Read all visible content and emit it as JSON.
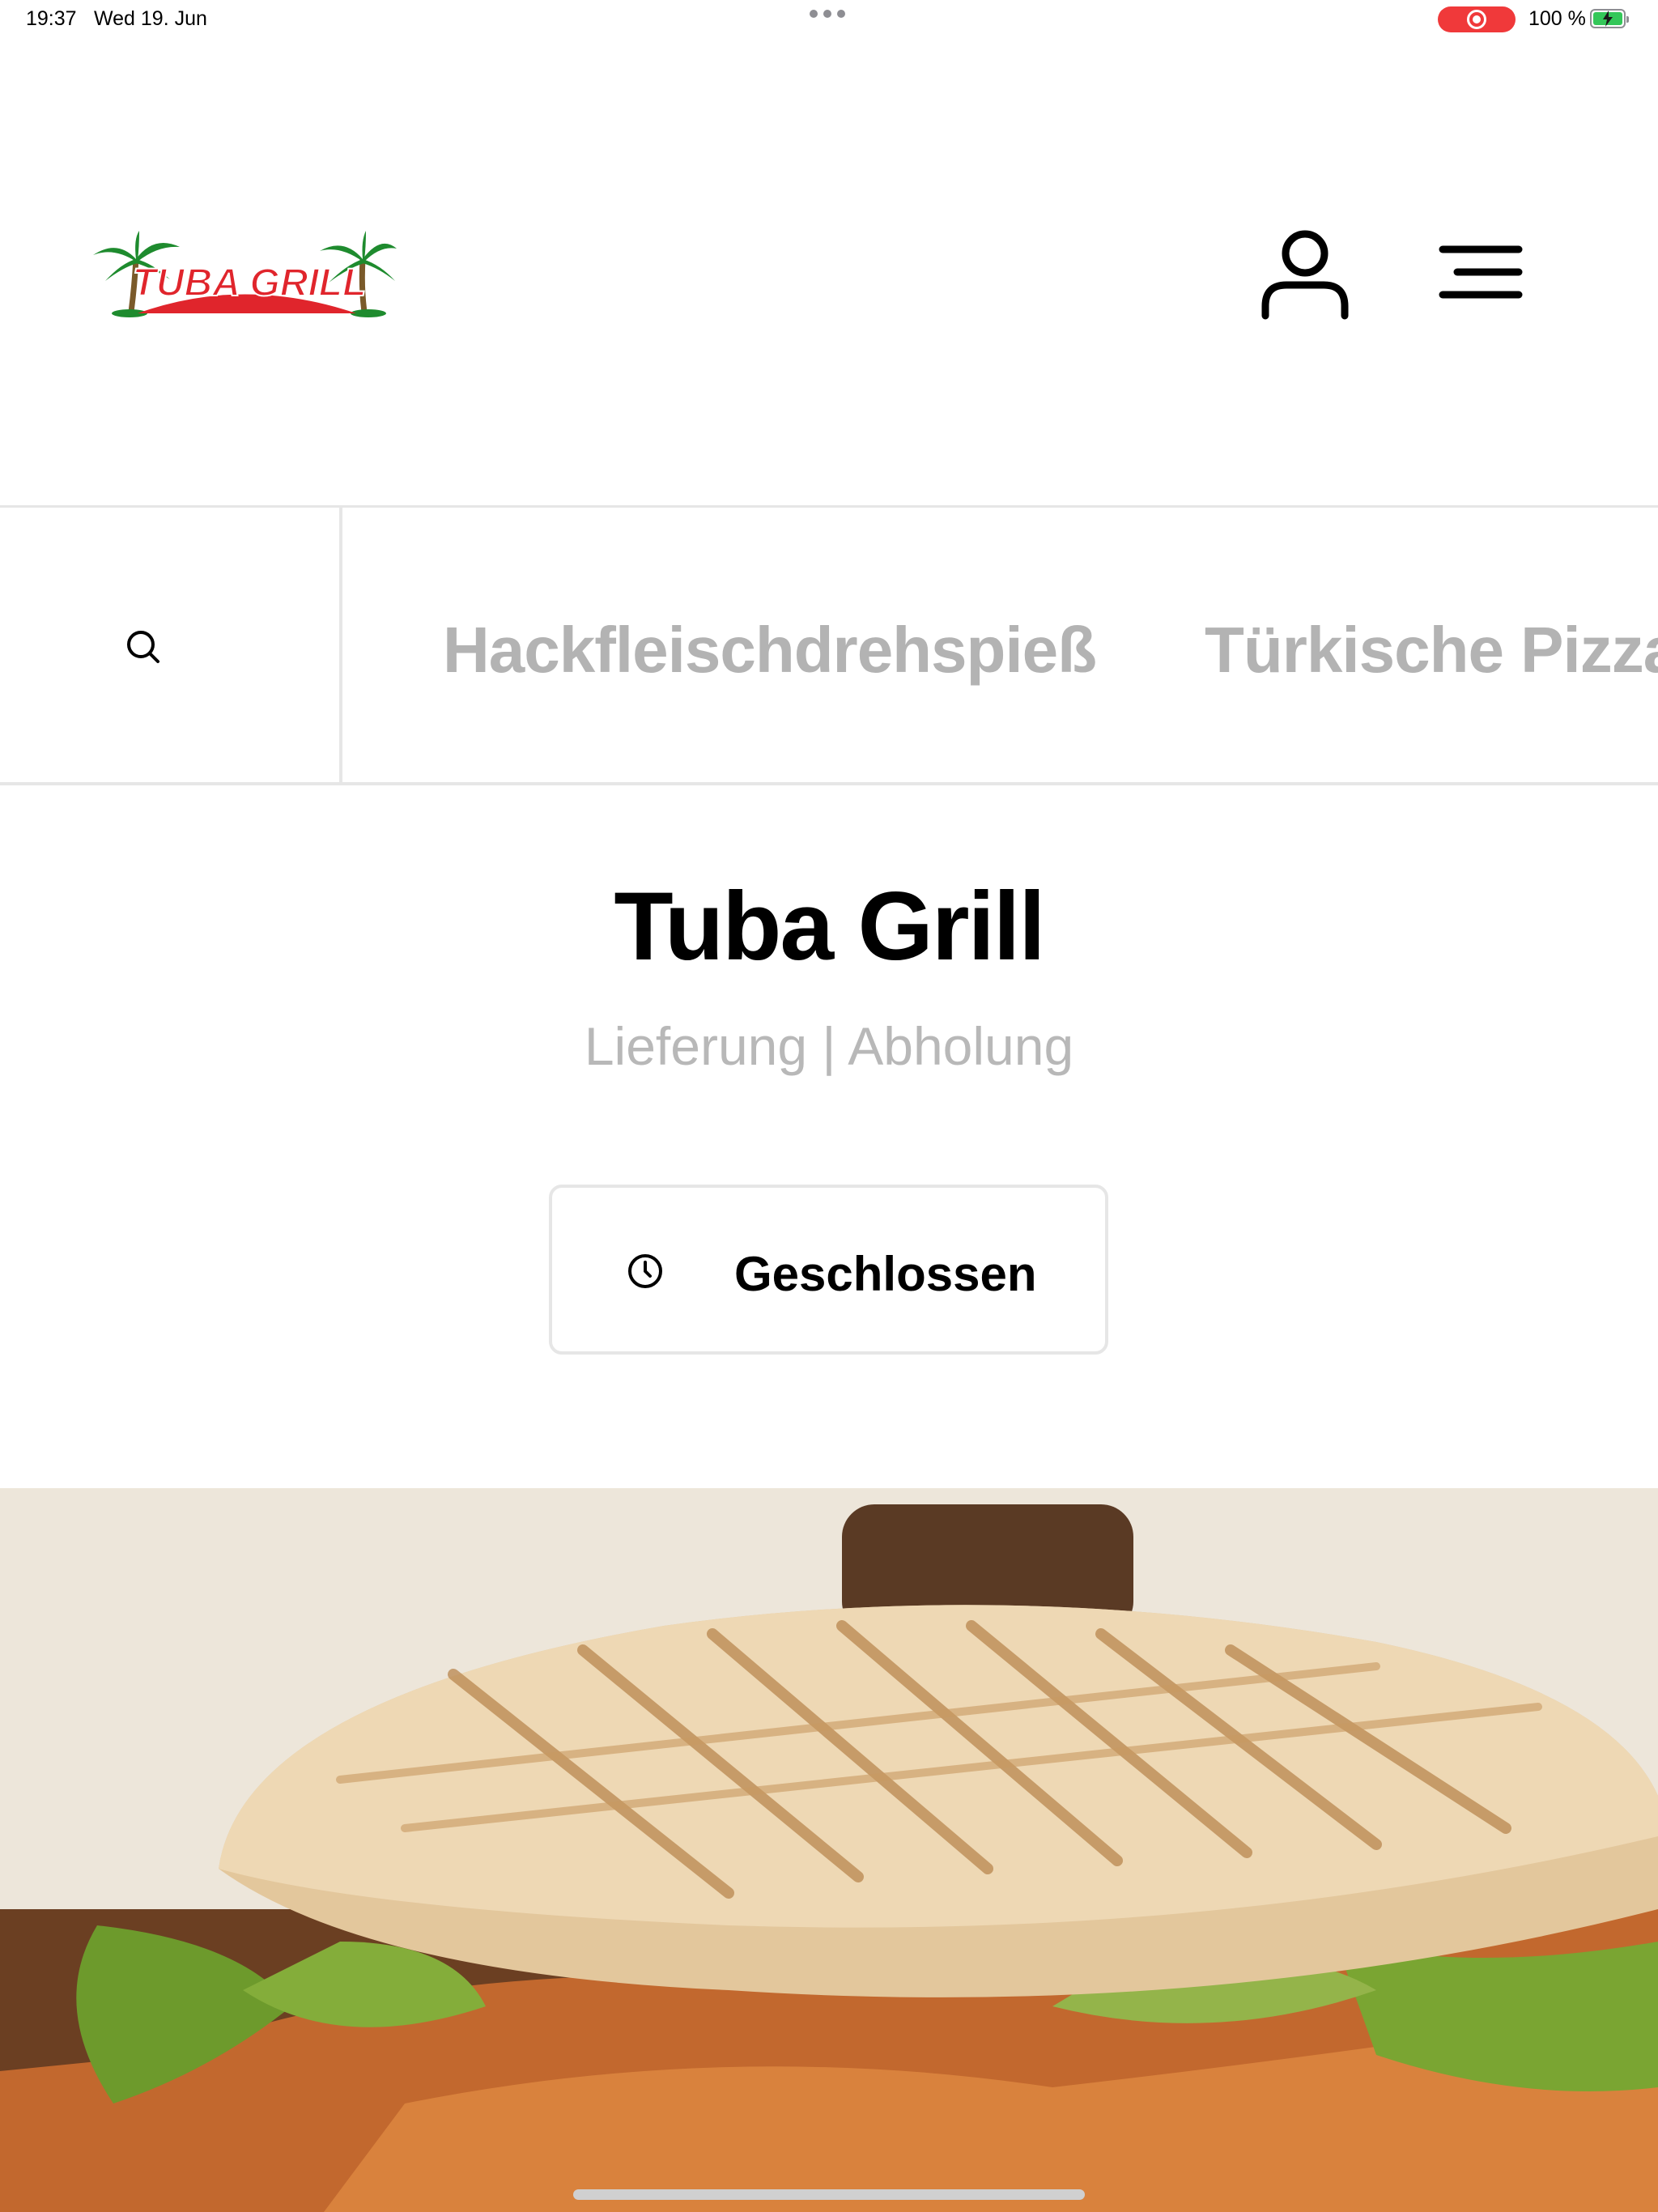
{
  "status_bar": {
    "time": "19:37",
    "date": "Wed 19. Jun",
    "battery": "100 %"
  },
  "header": {
    "logo_text": "TUBA GRILL"
  },
  "categories": {
    "items": [
      "Hackfleischdrehspieß",
      "Türkische Pizza"
    ]
  },
  "restaurant": {
    "name": "Tuba Grill",
    "service_modes": "Lieferung | Abholung",
    "status": "Geschlossen"
  },
  "colors": {
    "logo_red": "#e0252c",
    "logo_green": "#1e8b2e",
    "recording_red": "#f0393a",
    "battery_green": "#34c759",
    "inactive_tab": "#b3b3b3"
  }
}
